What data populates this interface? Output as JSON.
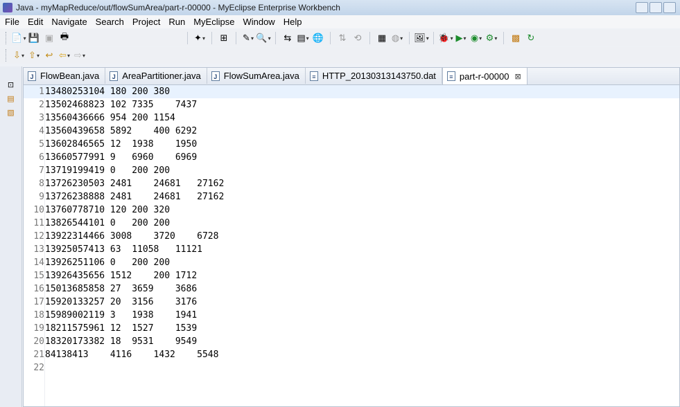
{
  "window": {
    "title": "Java - myMapReduce/out/flowSumArea/part-r-00000 - MyEclipse Enterprise Workbench"
  },
  "menu": [
    "File",
    "Edit",
    "Navigate",
    "Search",
    "Project",
    "Run",
    "MyEclipse",
    "Window",
    "Help"
  ],
  "tabs": [
    {
      "label": "FlowBean.java",
      "icon": "java-file-icon",
      "active": false
    },
    {
      "label": "AreaPartitioner.java",
      "icon": "java-file-icon",
      "active": false
    },
    {
      "label": "FlowSumArea.java",
      "icon": "java-file-icon",
      "active": false
    },
    {
      "label": "HTTP_20130313143750.dat",
      "icon": "text-file-icon",
      "active": false
    },
    {
      "label": "part-r-00000",
      "icon": "text-file-icon",
      "active": true
    }
  ],
  "editor": {
    "lines": [
      "13480253104\t180\t200\t380",
      "13502468823\t102\t7335\t7437",
      "13560436666\t954\t200\t1154",
      "13560439658\t5892\t400\t6292",
      "13602846565\t12\t1938\t1950",
      "13660577991\t9\t6960\t6969",
      "13719199419\t0\t200\t200",
      "13726230503\t2481\t24681\t27162",
      "13726238888\t2481\t24681\t27162",
      "13760778710\t120\t200\t320",
      "13826544101\t0\t200\t200",
      "13922314466\t3008\t3720\t6728",
      "13925057413\t63\t11058\t11121",
      "13926251106\t0\t200\t200",
      "13926435656\t1512\t200\t1712",
      "15013685858\t27\t3659\t3686",
      "15920133257\t20\t3156\t3176",
      "15989002119\t3\t1938\t1941",
      "18211575961\t12\t1527\t1539",
      "18320173382\t18\t9531\t9549",
      "84138413\t4116\t1432\t5548",
      ""
    ]
  }
}
